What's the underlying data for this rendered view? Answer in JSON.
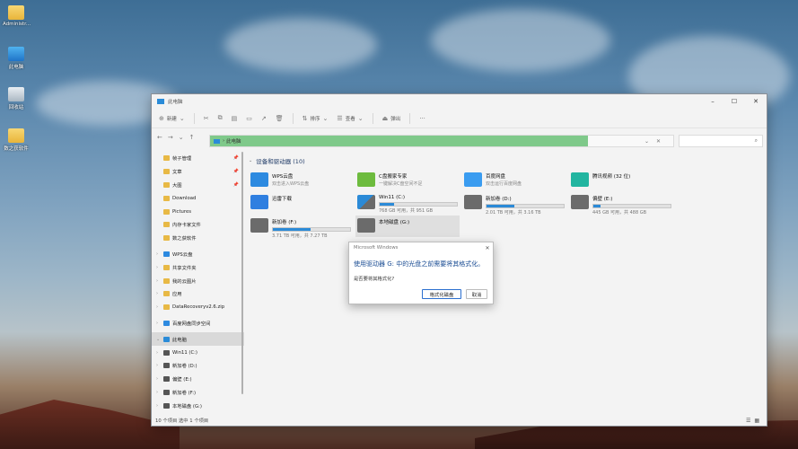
{
  "desktop": {
    "icons": [
      {
        "label": "Administr...",
        "icon": "folder-icon"
      },
      {
        "label": "此电脑",
        "icon": "pc-icon"
      },
      {
        "label": "回收站",
        "icon": "recycle-bin-icon"
      },
      {
        "label": "数之获软件",
        "icon": "folder-icon"
      }
    ]
  },
  "window": {
    "title": "此电脑",
    "controls": [
      "–",
      "☐",
      "✕"
    ],
    "toolbar": {
      "new_label": "新建",
      "sort_label": "排序",
      "view_label": "查看",
      "eject_label": "弹出",
      "more_label": "···"
    },
    "address": {
      "path": "此电脑",
      "search_placeholder": ""
    },
    "sidebar": {
      "items": [
        {
          "label": "帧子管理",
          "pinned": true,
          "expandable": false,
          "color": "#e8b945"
        },
        {
          "label": "文章",
          "pinned": true,
          "expandable": false,
          "color": "#e8b945"
        },
        {
          "label": "大图",
          "pinned": true,
          "expandable": false,
          "color": "#e8b945"
        },
        {
          "label": "Download",
          "pinned": false,
          "expandable": false,
          "color": "#e8b945"
        },
        {
          "label": "Pictures",
          "pinned": false,
          "expandable": false,
          "color": "#e8b945"
        },
        {
          "label": "内存卡家文件",
          "pinned": false,
          "expandable": false,
          "color": "#e8b945"
        },
        {
          "label": "数之获软件",
          "pinned": false,
          "expandable": false,
          "color": "#e8b945"
        },
        {
          "label": "WPS云盘",
          "pinned": false,
          "expandable": true,
          "color": "#2d8ae0"
        },
        {
          "label": "共享文件夹",
          "pinned": false,
          "expandable": true,
          "color": "#e8b945"
        },
        {
          "label": "我的云图片",
          "pinned": false,
          "expandable": true,
          "color": "#e8b945"
        },
        {
          "label": "应用",
          "pinned": false,
          "expandable": true,
          "color": "#e8b945"
        },
        {
          "label": "DataRecoveryv2.6.zip",
          "pinned": false,
          "expandable": true,
          "color": "#e8b945"
        },
        {
          "label": "百度网盘同步空间",
          "pinned": false,
          "expandable": true,
          "color": "#2d8ae0"
        },
        {
          "label": "此电脑",
          "pinned": false,
          "expandable": true,
          "color": "#2a8bd8",
          "selected": true
        },
        {
          "label": "Win11 (C:)",
          "pinned": false,
          "expandable": true,
          "color": "#555555"
        },
        {
          "label": "新加卷 (D:)",
          "pinned": false,
          "expandable": true,
          "color": "#555555"
        },
        {
          "label": "偏壁 (E:)",
          "pinned": false,
          "expandable": true,
          "color": "#555555"
        },
        {
          "label": "新加卷 (F:)",
          "pinned": false,
          "expandable": true,
          "color": "#555555"
        },
        {
          "label": "本地磁盘 (G:)",
          "pinned": false,
          "expandable": true,
          "color": "#555555"
        }
      ]
    },
    "section_title": "设备和驱动器 (10)",
    "tiles": [
      {
        "name": "WPS云盘",
        "sub": "双击进入WPS云盘",
        "icon": "wps-cloud-icon",
        "color": "#2d8ae0"
      },
      {
        "name": "C盘搬家专家",
        "sub": "一键解决C盘空间不足",
        "icon": "c-drive-expert-icon",
        "color": "#6dbb3e"
      },
      {
        "name": "百度网盘",
        "sub": "双击运行百度网盘",
        "icon": "baidu-netdisk-icon",
        "color": "#3a9cf0"
      },
      {
        "name": "腾讯视频 (32 位)",
        "sub": "",
        "icon": "tencent-video-icon",
        "color": "#22b5a0"
      },
      {
        "name": "迅雷下载",
        "sub": "",
        "icon": "thunder-icon",
        "color": "#2f7fe0"
      },
      {
        "name": "Win11 (C:)",
        "cap": "768 GB 可用，共 951 GB",
        "usage": 0.19,
        "icon": "windows-drive-icon",
        "color": "#2b8ad7"
      },
      {
        "name": "新加卷 (D:)",
        "cap": "2.01 TB 可用，共 3.16 TB",
        "usage": 0.36,
        "icon": "drive-icon",
        "color": "#2b8ad7"
      },
      {
        "name": "偏壁 (E:)",
        "cap": "445 GB 可用，共 488 GB",
        "usage": 0.09,
        "icon": "drive-icon",
        "color": "#2b8ad7"
      },
      {
        "name": "新加卷 (F:)",
        "cap": "3.71 TB 可用，共 7.27 TB",
        "usage": 0.49,
        "icon": "drive-icon",
        "color": "#2b8ad7"
      },
      {
        "name": "本地磁盘 (G:)",
        "cap": "",
        "icon": "drive-icon",
        "selected": true,
        "color": "#2b8ad7"
      }
    ],
    "status": "10 个项目    选中 1 个项目"
  },
  "dialog": {
    "title": "Microsoft Windows",
    "message": "使用驱动器 G: 中的光盘之前需要将其格式化。",
    "question": "是否要将其格式化?",
    "format_label": "格式化磁盘",
    "cancel_label": "取消"
  }
}
